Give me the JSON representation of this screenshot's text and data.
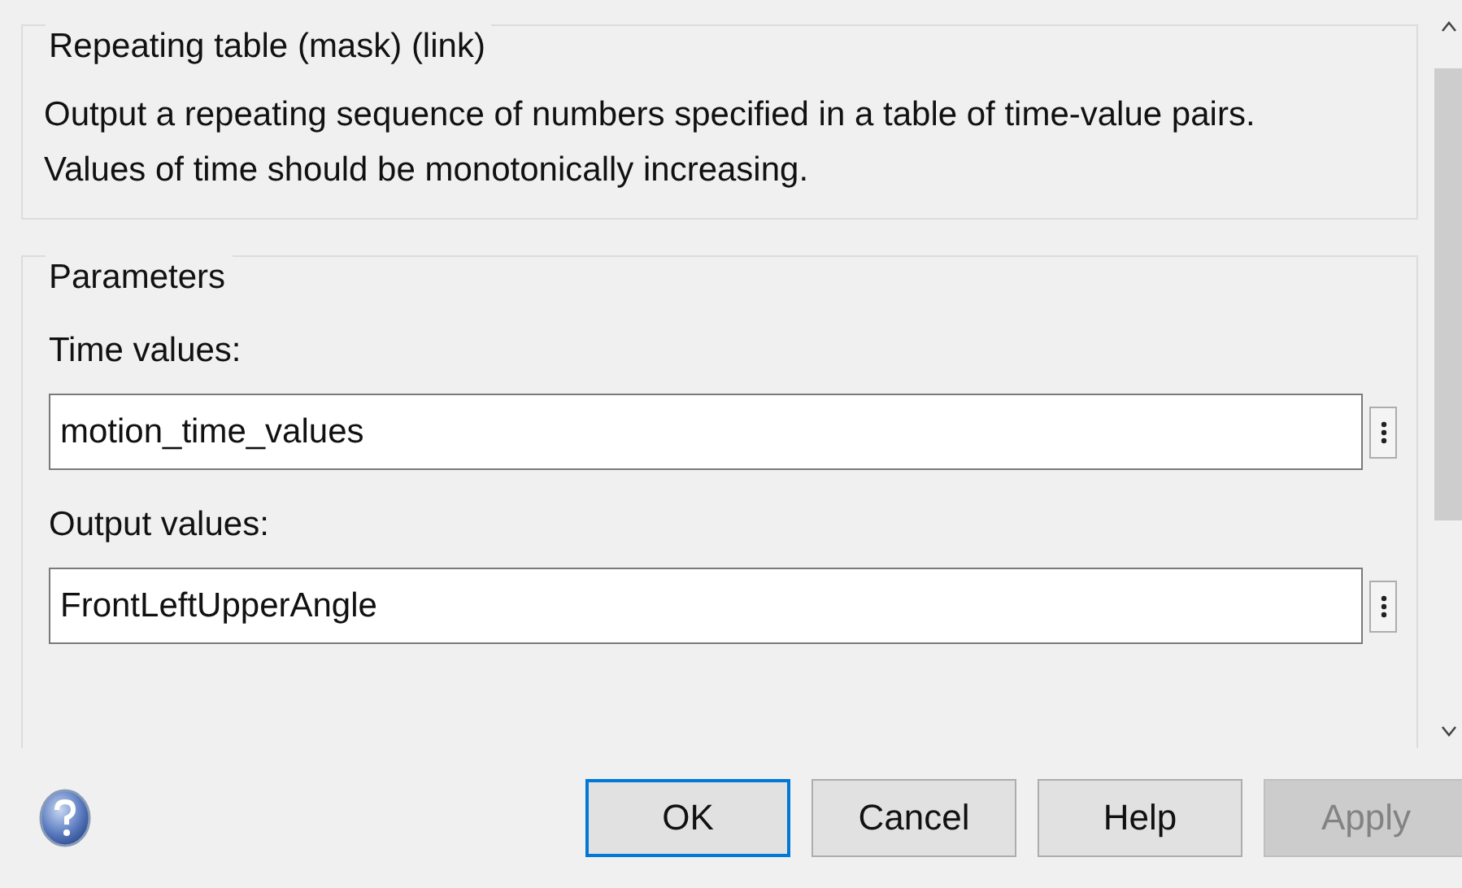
{
  "description_group": {
    "title": "Repeating table (mask) (link)",
    "text": "Output a repeating sequence of numbers specified in a table of time-value pairs.\nValues of time should be monotonically increasing."
  },
  "parameters": {
    "title": "Parameters",
    "fields": [
      {
        "label": "Time values:",
        "value": "motion_time_values"
      },
      {
        "label": "Output values:",
        "value": "FrontLeftUpperAngle"
      }
    ]
  },
  "buttons": [
    {
      "label": "OK",
      "default": true,
      "disabled": false
    },
    {
      "label": "Cancel",
      "default": false,
      "disabled": false
    },
    {
      "label": "Help",
      "default": false,
      "disabled": false
    },
    {
      "label": "Apply",
      "default": false,
      "disabled": true
    }
  ]
}
